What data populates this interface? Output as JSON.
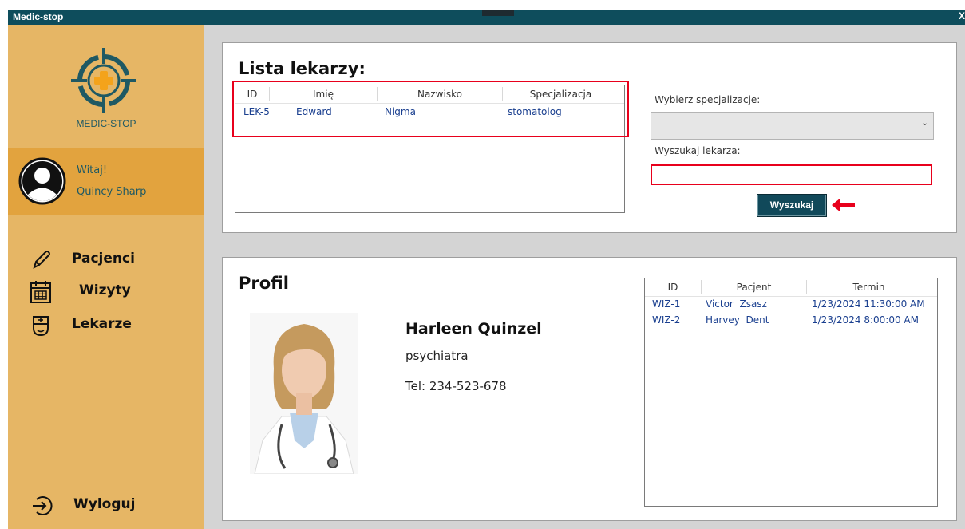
{
  "window": {
    "title": "Medic-stop",
    "close_label": "X"
  },
  "sidebar": {
    "logo_text": "MEDIC-STOP",
    "greeting": "Witaj!",
    "user_name": "Quincy Sharp",
    "nav": [
      {
        "label": "Pacjenci",
        "icon": "pencil-icon"
      },
      {
        "label": "Wizyty",
        "icon": "calendar-icon"
      },
      {
        "label": "Lekarze",
        "icon": "doctor-icon"
      }
    ],
    "logout_label": "Wyloguj",
    "logout_icon": "logout-icon"
  },
  "colors": {
    "sidebar_bg": "#e6b665",
    "user_panel_bg": "#e2a33e",
    "titlebar_bg": "#0e4d5c",
    "button_bg": "#11495a",
    "link_text": "#1a3f8f",
    "highlight_red": "#e8001c"
  },
  "doctors_panel": {
    "title": "Lista lekarzy:",
    "columns": [
      "ID",
      "Imię",
      "Nazwisko",
      "Specjalizacja"
    ],
    "rows": [
      {
        "id": "LEK-5",
        "first_name": "Edward",
        "last_name": "Nigma",
        "specialization": "stomatolog"
      }
    ],
    "specialization_label": "Wybierz specjalizacje:",
    "specialization_value": "",
    "search_label": "Wyszukaj lekarza:",
    "search_value": "",
    "search_button": "Wyszukaj"
  },
  "profile_panel": {
    "title": "Profil",
    "name": "Harleen Quinzel",
    "specialization": "psychiatra",
    "phone": "Tel: 234-523-678",
    "visits_columns": [
      "ID",
      "Pacjent",
      "Termin"
    ],
    "visits": [
      {
        "id": "WIZ-1",
        "patient": "Victor  Zsasz",
        "date": "1/23/2024 11:30:00 AM"
      },
      {
        "id": "WIZ-2",
        "patient": "Harvey  Dent",
        "date": "1/23/2024 8:00:00 AM"
      }
    ]
  }
}
